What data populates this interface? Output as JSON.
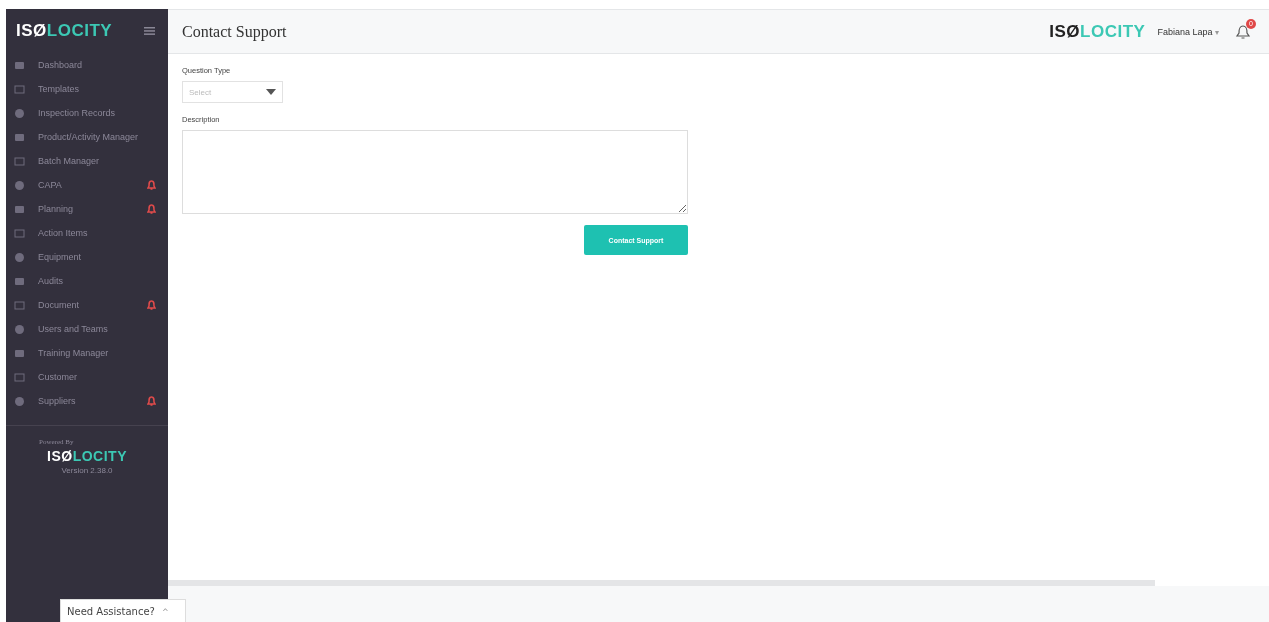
{
  "sidebar": {
    "logo": {
      "lead": "ISØ",
      "accent": "LOCITY"
    },
    "items": [
      {
        "label": "Dashboard",
        "alert": false
      },
      {
        "label": "Templates",
        "alert": false
      },
      {
        "label": "Inspection Records",
        "alert": false
      },
      {
        "label": "Product/Activity Manager",
        "alert": false
      },
      {
        "label": "Batch Manager",
        "alert": false
      },
      {
        "label": "CAPA",
        "alert": true
      },
      {
        "label": "Planning",
        "alert": true
      },
      {
        "label": "Action Items",
        "alert": false
      },
      {
        "label": "Equipment",
        "alert": false
      },
      {
        "label": "Audits",
        "alert": false
      },
      {
        "label": "Document",
        "alert": true
      },
      {
        "label": "Users and Teams",
        "alert": false
      },
      {
        "label": "Training Manager",
        "alert": false
      },
      {
        "label": "Customer",
        "alert": false
      },
      {
        "label": "Suppliers",
        "alert": true
      }
    ],
    "powered_by": "Powered By",
    "footer_logo": {
      "lead": "ISØ",
      "accent": "LOCITY"
    },
    "version": "Version 2.38.0"
  },
  "header": {
    "title": "Contact Support",
    "logo": {
      "lead": "ISØ",
      "accent": "LOCITY"
    },
    "user": "Fabiana Lapa",
    "user_caret": "▾",
    "notification_count": "0"
  },
  "form": {
    "question_type": {
      "label": "Question Type",
      "placeholder": "Select"
    },
    "description": {
      "label": "Description"
    },
    "submit": "Contact Support"
  },
  "assist": {
    "label": "Need Assistance?",
    "caret": "^"
  }
}
